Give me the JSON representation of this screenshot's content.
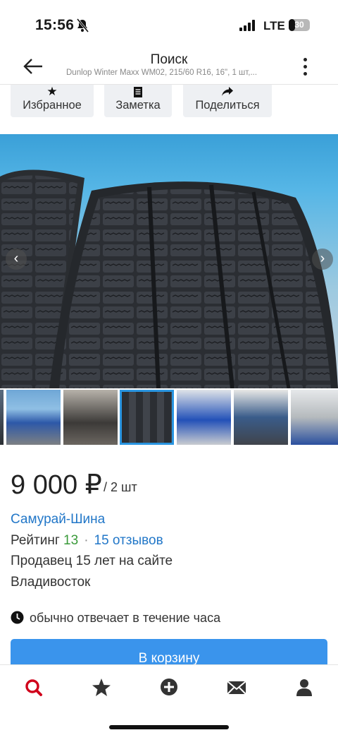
{
  "status_bar": {
    "time": "15:56",
    "network": "LTE",
    "battery": "30",
    "battery_level": 0.3
  },
  "header": {
    "title": "Поиск",
    "subtitle": "Dunlop Winter Maxx WM02, 215/60 R16, 16\", 1 шт,..."
  },
  "actions": [
    {
      "label": "Избранное",
      "icon": "star-icon"
    },
    {
      "label": "Заметка",
      "icon": "note-icon"
    },
    {
      "label": "Поделиться",
      "icon": "share-icon"
    }
  ],
  "gallery": {
    "main_photo": "winter-tire-tread",
    "thumbnails": [
      "tire-partial",
      "shop-building",
      "garage-interior",
      "tire-tread",
      "car-lift",
      "tire-service-interior",
      "service-bay"
    ],
    "active_thumbnail": 3
  },
  "listing": {
    "price": "9 000 ₽",
    "price_unit": "/ 2 шт",
    "seller": "Самурай-Шина",
    "rating_label": "Рейтинг",
    "rating_value": "13",
    "reviews": "15 отзывов",
    "seller_age": "Продавец 15 лет на сайте",
    "city": "Владивосток",
    "reply_time": "обычно отвечает в течение часа",
    "cart_label": "В корзину"
  },
  "tab_bar": [
    {
      "icon": "search-icon",
      "color": "#d0021b"
    },
    {
      "icon": "star-icon",
      "color": "#333333"
    },
    {
      "icon": "add-icon",
      "color": "#333333"
    },
    {
      "icon": "mail-icon",
      "color": "#333333"
    },
    {
      "icon": "profile-icon",
      "color": "#333333"
    }
  ],
  "colors": {
    "accent": "#3a94ec",
    "link": "#2277c8",
    "rating": "#3a9a3a",
    "active_tab": "#d0021b"
  }
}
